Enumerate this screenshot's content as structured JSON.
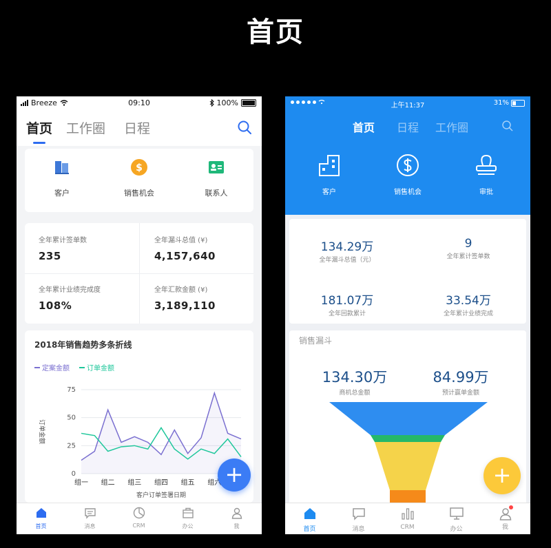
{
  "page_title": "首页",
  "phone_left": {
    "status_bar": {
      "carrier": "Breeze",
      "time": "09:10",
      "battery": "100%"
    },
    "tabs": [
      {
        "label": "首页",
        "active": true
      },
      {
        "label": "工作圈"
      },
      {
        "label": "日程"
      }
    ],
    "quick_actions": [
      {
        "label": "客户",
        "icon": "building-icon"
      },
      {
        "label": "销售机会",
        "icon": "dollar-coin-icon"
      },
      {
        "label": "联系人",
        "icon": "contact-card-icon"
      }
    ],
    "stats": [
      {
        "label": "全年累计签单数",
        "value": "235"
      },
      {
        "label": "全年漏斗总值 (¥)",
        "value": "4,157,640"
      },
      {
        "label": "全年累计业绩完成度",
        "value": "108%"
      },
      {
        "label": "全年汇款金额 (¥)",
        "value": "3,189,110"
      }
    ],
    "chart_data": {
      "type": "line",
      "title": "2018年销售趋势多条折线",
      "xlabel": "客户订单签署日期",
      "ylabel": "订单金额",
      "ylim": [
        0,
        75
      ],
      "yticks": [
        0,
        25,
        50,
        75
      ],
      "categories": [
        "组一",
        "组二",
        "组三",
        "组四",
        "组五",
        "组六"
      ],
      "x": [
        0,
        0.5,
        1,
        1.5,
        2,
        2.5,
        3,
        3.5,
        4,
        4.5,
        5,
        5.5,
        6
      ],
      "series": [
        {
          "name": "定案金额",
          "color": "#7a6fd0",
          "values": [
            12,
            20,
            57,
            28,
            33,
            28,
            17,
            39,
            18,
            32,
            72,
            36,
            31
          ]
        },
        {
          "name": "订单金额",
          "color": "#1fc79b",
          "values": [
            36,
            34,
            20,
            24,
            25,
            22,
            41,
            22,
            13,
            22,
            18,
            31,
            15
          ]
        }
      ],
      "grid": true
    },
    "fab_label": "+",
    "bottom_nav": [
      {
        "label": "首页",
        "icon": "home-icon",
        "active": true
      },
      {
        "label": "消息",
        "icon": "message-icon"
      },
      {
        "label": "CRM",
        "icon": "pie-chart-icon"
      },
      {
        "label": "办公",
        "icon": "briefcase-icon"
      },
      {
        "label": "我",
        "icon": "person-icon"
      }
    ],
    "colors": {
      "accent": "#2d6cf0",
      "fab": "#3b7cf5"
    }
  },
  "phone_right": {
    "status_bar": {
      "time": "上午11:37",
      "battery": "31%"
    },
    "tabs": [
      {
        "label": "首页",
        "active": true
      },
      {
        "label": "日程"
      },
      {
        "label": "工作圈"
      }
    ],
    "quick_actions": [
      {
        "label": "客户",
        "icon": "building-icon"
      },
      {
        "label": "销售机会",
        "icon": "dollar-coin-icon"
      },
      {
        "label": "审批",
        "icon": "stamp-icon"
      }
    ],
    "stats": [
      {
        "value": "134.29万",
        "label": "全年漏斗总值（元）"
      },
      {
        "value": "9",
        "label": "全年累计签单数"
      },
      {
        "value": "181.07万",
        "label": "全年回款累计"
      },
      {
        "value": "33.54万",
        "label": "全年累计业绩完成"
      }
    ],
    "funnel": {
      "title": "销售漏斗",
      "values": [
        {
          "value": "134.30万",
          "label": "商机总金额"
        },
        {
          "value": "84.99万",
          "label": "预计赢单金额"
        }
      ],
      "stage_colors": [
        "#2e8df0",
        "#25b86a",
        "#f5d34a",
        "#f58a1a"
      ]
    },
    "fab_label": "+",
    "bottom_nav": [
      {
        "label": "首页",
        "icon": "home-icon",
        "active": true
      },
      {
        "label": "消息",
        "icon": "message-icon"
      },
      {
        "label": "CRM",
        "icon": "bar-chart-icon"
      },
      {
        "label": "办公",
        "icon": "monitor-icon"
      },
      {
        "label": "我",
        "icon": "person-icon",
        "badge": true
      }
    ],
    "colors": {
      "header": "#1e8bf0",
      "fab": "#fcc93a"
    }
  }
}
